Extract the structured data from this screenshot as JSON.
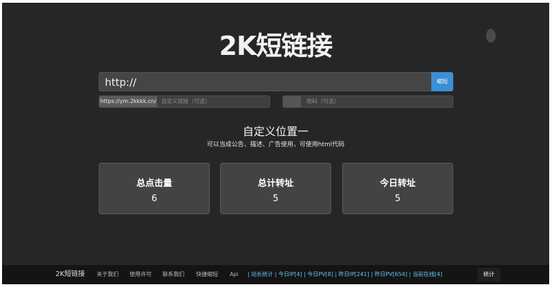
{
  "header": {
    "title": "2K短链接"
  },
  "form": {
    "url_value": "http://",
    "shorten_label": "缩短",
    "domain_prefix": "https://ym.2kkkk.cn/",
    "custom_placeholder": "自定义链接（可选）",
    "password_placeholder": "密码（可选）"
  },
  "ad": {
    "title": "自定义位置一",
    "subtitle": "可以当成公告、描述、广告使用，可使用html代码"
  },
  "stats": [
    {
      "label": "总点击量",
      "value": "6"
    },
    {
      "label": "总计转址",
      "value": "5"
    },
    {
      "label": "今日转址",
      "value": "5"
    }
  ],
  "footer": {
    "brand": "2K短链接",
    "links": [
      "关于我们",
      "使用许可",
      "联系我们",
      "快捷缩短",
      "Api"
    ],
    "stats_text": "| 站长统计 | 今日IP[4] | 今日PV[8] | 昨日IP[241] | 昨日PV[654] | 当前在线[4]",
    "stat_button": "统计"
  }
}
